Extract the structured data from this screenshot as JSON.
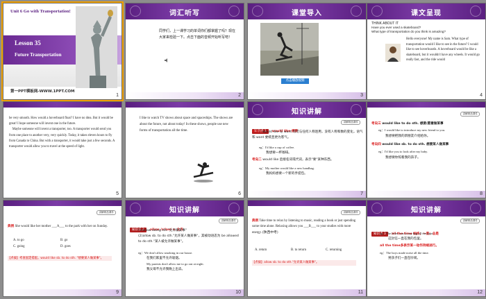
{
  "colors": {
    "accent": "#6a2a92",
    "header": "#5a1f80",
    "highlight": "#d81a1a",
    "selection": "#f0a000"
  },
  "slides": [
    {
      "num": "1",
      "unit": "Unit 6    Go with Transportation!",
      "lesson": "Lesson 35",
      "subtitle": "Future Transportation",
      "site": "第一PPT模板网-WWW.1PPT.COM"
    },
    {
      "num": "2",
      "header": "词汇听写",
      "text": "同学们，上一课学习的单词你们都掌握了吗？现在大家来检验一下。点击下面的音频开始听写吧！"
    },
    {
      "num": "3",
      "header": "课堂导入",
      "caption": "点击播放视频"
    },
    {
      "num": "4",
      "header": "课文呈现",
      "think": "THINK ABOUT IT",
      "q1": "Have you ever used a skateboard?",
      "q2": "What type of transportation do you think is amazing?",
      "body": "Hello everyone! My name is Sam. What type of transportation would I like to see in the future? I would like to see hoverboards. A hoverboard would be like a skateboard, but it wouldn't have any wheels. It would go really fast, and the ride would"
    },
    {
      "num": "5",
      "body": "be very smooth. How would a hoverboard float? I have no idea. But it would be great! I hope someone will invent one in the future.\n    Maybe someone will invent a transporter, too. A transporter would send you from one place to another very, very quickly. Today, it takes eleven hours to fly from Canada to China. But with a transporter, it would take just a few seconds. A transporter would allow you to travel at the speed of light."
    },
    {
      "num": "6",
      "body": "I like to watch TV shows about space and spaceships. The shows are about the future, not about today! In these shows, people use new forms of transportation all the time."
    },
    {
      "num": "7",
      "header": "知识讲解",
      "badge_tag": "知识点 1",
      "point": "would like 想要",
      "tag_label": "讲解精品课件",
      "k1_label": "考向一",
      "k1": "would like 与 want 均可与任何人称连用，没有人称和数的变化，语气和 want 委婉且更为客气。",
      "eg1": "eg：I'd like a cup of coffee.",
      "eg1_cn": "我想要一杯咖啡。",
      "k2_label": "考向二",
      "k2": "would like 后接名词或代词，表示\"要\"某种东西。",
      "eg2": "eg：My mother would like a new handbag.",
      "eg2_cn": "我妈妈想要一个新的手提包。"
    },
    {
      "num": "8",
      "tag_label": "讲解精品课件",
      "k3_label": "考向三",
      "k3": "would like to do sth. 想要/愿意做某事",
      "eg3": "eg：I would like to introduce my new friend to you.",
      "eg3_cn": "我想要把我的新朋友介绍给你。",
      "k4_label": "考向四",
      "k4": "would like sb. to do sth. 想要某人做某事",
      "eg4": "eg：I'd like you to look after my baby.",
      "eg4_cn": "我想要你照看我的孩子。"
    },
    {
      "num": "9",
      "tag_label": "讲解精品课件",
      "ex_label": "典例",
      "ex": "She would like her mother ___A___ to the park with her on Sunday.",
      "opts": [
        "A. to go",
        "B. go",
        "C. going",
        "D. goes"
      ],
      "tip": "【点拨】考查固定搭配。would like sb. to do sth. \"想要某人做某事\"。"
    },
    {
      "num": "10",
      "header": "知识讲解",
      "badge_tag": "知识点 2",
      "point": "allow /əˈlaʊ/ v. 允许",
      "tag_label": "讲解精品课件",
      "l1": "(1)allow doing sth.\"允许做某事\"",
      "l2": "(2)allow sb. to do sth.\"允许某人做某事\"，其被动语态为 be allowed to do sth.\"某人被允许做某事\"。",
      "eg1": "eg：We don't allow smoking in our house.",
      "eg1_cn": "在我们家里不允许吸烟。",
      "eg2": "My parents don't allow me to go out at night.",
      "eg2_cn": "我父母不允许我晚上出去。"
    },
    {
      "num": "11",
      "tag_label": "讲解精品课件",
      "ex_label": "典例",
      "ex": "Take time to relax by listening to music, reading a book or just spending some time alone. Relaxing allows you ___B___ to your studies with more energy. (陕西中考)",
      "opts": [
        "A. return",
        "B. to return",
        "C. returning"
      ],
      "tip": "【点拨】allow sb. to do sth.\"允许某人做某事\"。"
    },
    {
      "num": "12",
      "header": "知识讲解",
      "tag_label": "讲解精品课件",
      "badge_tag": "知识点 3",
      "l1": "all the time 始终；一直；总是",
      "eg1": "eg：The letter was in my bag all the time.",
      "eg1_cn": "这封信一直在我的包里。",
      "l2": "all the time多表示某一动作持续进行。",
      "eg2": "eg：The boys made noise all the time.",
      "eg2_cn": "男孩子们一直在吵闹。"
    }
  ]
}
